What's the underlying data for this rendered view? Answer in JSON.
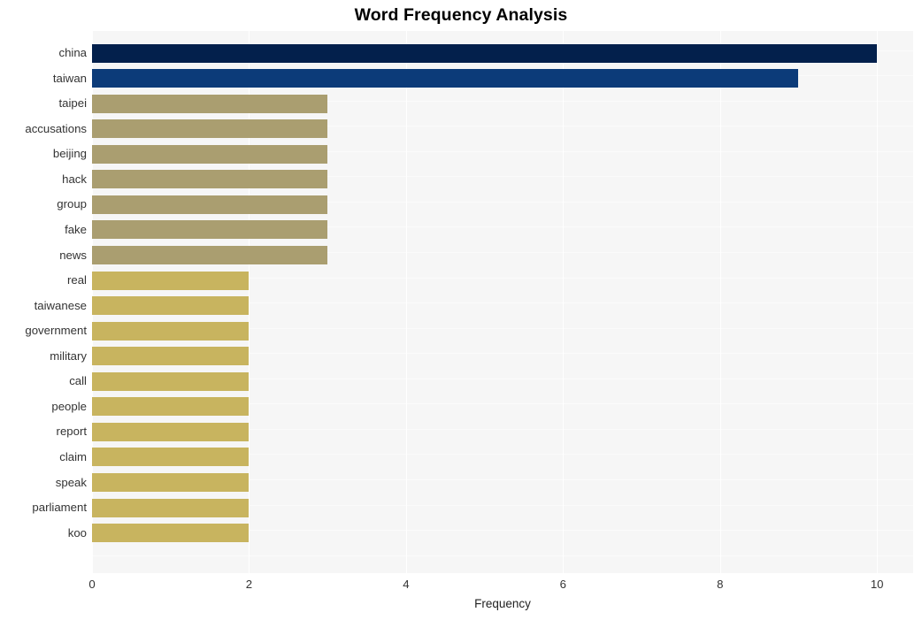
{
  "chart_data": {
    "type": "bar",
    "orientation": "horizontal",
    "title": "Word Frequency Analysis",
    "xlabel": "Frequency",
    "ylabel": "",
    "categories": [
      "china",
      "taiwan",
      "taipei",
      "accusations",
      "beijing",
      "hack",
      "group",
      "fake",
      "news",
      "real",
      "taiwanese",
      "government",
      "military",
      "call",
      "people",
      "report",
      "claim",
      "speak",
      "parliament",
      "koo"
    ],
    "values": [
      10,
      9,
      3,
      3,
      3,
      3,
      3,
      3,
      3,
      2,
      2,
      2,
      2,
      2,
      2,
      2,
      2,
      2,
      2,
      2
    ],
    "bar_colors": [
      "#03204c",
      "#0c3b79",
      "#aa9e70",
      "#aa9e70",
      "#aa9e70",
      "#aa9e70",
      "#aa9e70",
      "#aa9e70",
      "#aa9e70",
      "#c8b45f",
      "#c8b45f",
      "#c8b45f",
      "#c8b45f",
      "#c8b45f",
      "#c8b45f",
      "#c8b45f",
      "#c8b45f",
      "#c8b45f",
      "#c8b45f",
      "#c8b45f"
    ],
    "xlim": [
      0,
      10.46
    ],
    "xticks": [
      0,
      2,
      4,
      6,
      8,
      10
    ],
    "xticklabels": [
      "0",
      "2",
      "4",
      "6",
      "8",
      "10"
    ],
    "grid": {
      "vertical": true,
      "horizontal": true
    },
    "legend": null,
    "plot_background": "#f6f6f6",
    "figure_background": "#ffffff",
    "gridline_color": "#ffffff"
  }
}
